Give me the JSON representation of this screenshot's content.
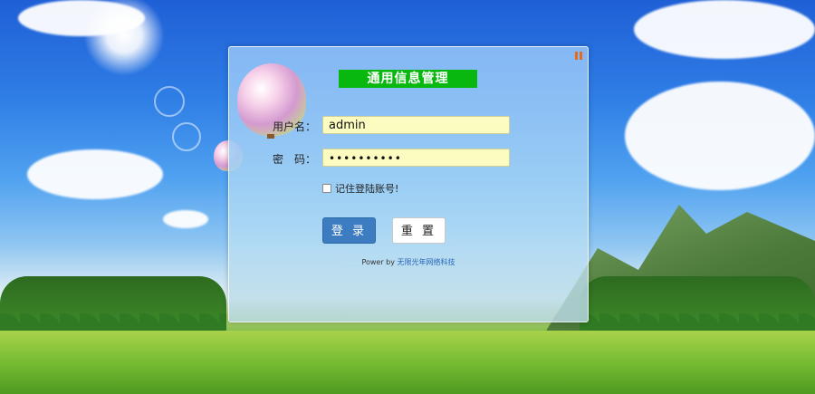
{
  "window": {
    "title": "通用信息管理"
  },
  "form": {
    "username_label": "用户名：",
    "username_value": "admin",
    "password_label": "密　码：",
    "password_value": "••••••••••",
    "remember_label": "记住登陆账号!",
    "remember_checked": false,
    "login_button": "登 录",
    "reset_button": "重 置"
  },
  "footer": {
    "power_prefix": "Power by ",
    "power_link": "无限光年网络科技"
  },
  "colors": {
    "title_bg": "#09b80f",
    "login_bg": "#3d7cc0",
    "input_bg": "#fcfcc0",
    "icon": "#e86b1a"
  },
  "icons": [
    "pause-icon",
    "balloon-image",
    "checkbox"
  ]
}
